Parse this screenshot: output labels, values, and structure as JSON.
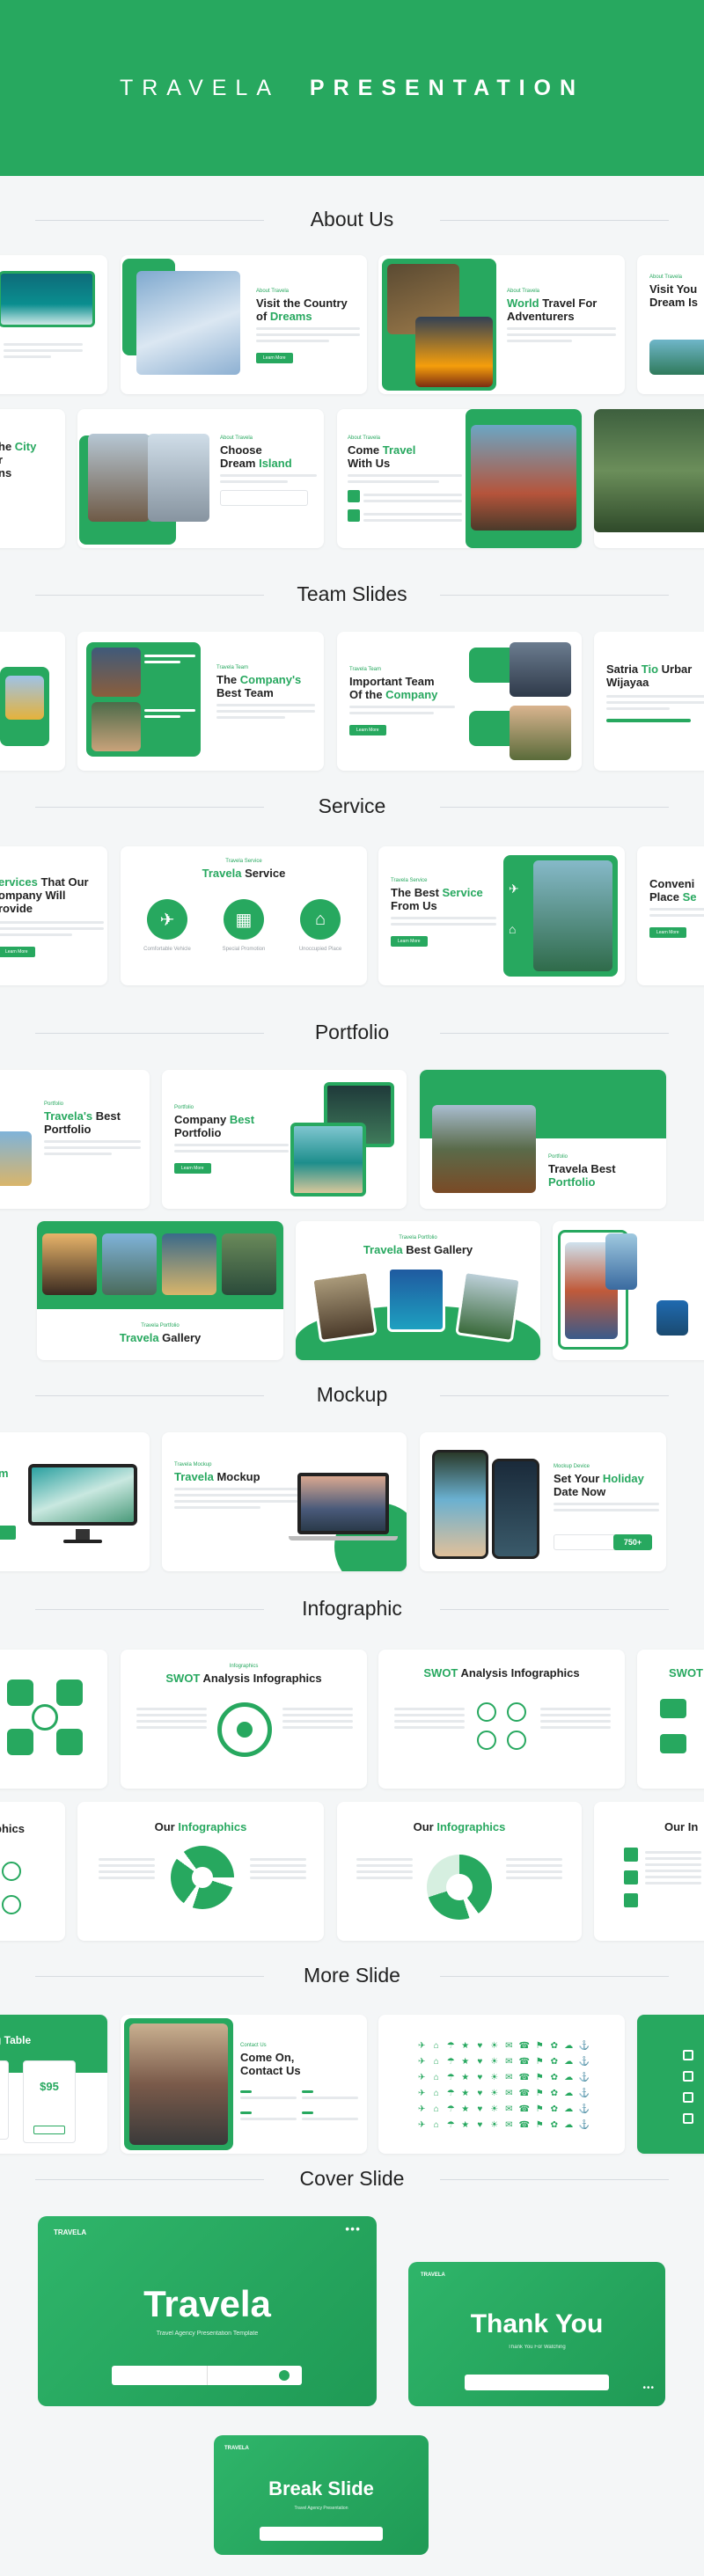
{
  "hero": {
    "title_light": "TRAVELA",
    "title_bold": "PRESENTATION"
  },
  "sections": {
    "about": "About Us",
    "team": "Team Slides",
    "service": "Service",
    "portfolio": "Portfolio",
    "mockup": "Mockup",
    "infographic": "Infographic",
    "more": "More Slide",
    "cover": "Cover Slide"
  },
  "about": {
    "c1": {
      "a": "Visit the Country",
      "b": "of ",
      "c": "Dreams"
    },
    "c2": {
      "a": "World",
      "b": " Travel For Adventurers"
    },
    "c3": {
      "a": "Visit You",
      "b": "Dream Is"
    },
    "c4": {
      "a": "he ",
      "b": "City",
      "c": "r",
      "d": "ns"
    },
    "c5": {
      "a": "Choose",
      "b": "Dream ",
      "c": "Island"
    },
    "c6": {
      "a": "Come ",
      "b": "Travel",
      "c": "With Us"
    }
  },
  "team": {
    "c1": {
      "a": "The ",
      "b": "Company's",
      "c": "Best Team"
    },
    "c2": {
      "a": "Important Team",
      "b": "Of the ",
      "c": "Company"
    },
    "c3": {
      "a": "Satria ",
      "b": "Tio",
      "c": " Urbar",
      "d": "Wijayaa"
    }
  },
  "service": {
    "c1": {
      "a": "ervices",
      "b": " That Our",
      "c": "ompany Will",
      "d": "rovide"
    },
    "c2": {
      "a": "Travela",
      "b": " Service"
    },
    "c3": {
      "a": "The Best ",
      "b": "Service",
      "c": "From Us"
    },
    "c4": {
      "a": "Conveni",
      "b": "Place ",
      "c": "Se"
    }
  },
  "portfolio": {
    "c1": {
      "a": "Travela's",
      "b": " Best",
      "c": "Portfolio"
    },
    "c2": {
      "a": "Company ",
      "b": "Best",
      "c": "Portfolio"
    },
    "c3": {
      "a": "Travela Best",
      "b": "Portfolio"
    },
    "c4": {
      "a": "Travela",
      "b": " Gallery"
    },
    "c5": {
      "a": "Travela",
      "b": " Best Gallery"
    }
  },
  "mockup": {
    "c1": {
      "a": "m"
    },
    "c2": {
      "a": "Travela",
      "b": " Mockup"
    },
    "c3": {
      "a": "Set Your ",
      "b": "Holiday",
      "c": "Date Now",
      "price": "750+"
    }
  },
  "infographic": {
    "c1": {
      "a": "SWOT",
      "b": " Analysis Infographics"
    },
    "c2": {
      "a": "SWOT",
      "b": " Analysis Infographics"
    },
    "c3": {
      "a": "SWOT"
    },
    "c4": {
      "a": "phics"
    },
    "c5": {
      "a": "Our ",
      "b": "Infographics"
    },
    "c6": {
      "a": "Our ",
      "b": "Infographics"
    },
    "c7": {
      "a": "Our In"
    }
  },
  "more": {
    "c1": {
      "a": "g Table",
      "price": "$95"
    },
    "c2": {
      "a": "Come On,",
      "b": "Contact Us"
    }
  },
  "cover": {
    "main": {
      "title": "Travela",
      "sub": "Travel Agency Presentation Template",
      "brand": "TRAVELA"
    },
    "thanks": {
      "title": "Thank You",
      "sub": "Thank You For Watching",
      "brand": "TRAVELA"
    },
    "break": {
      "title": "Break Slide",
      "sub": "Travel Agency Presentation",
      "brand": "TRAVELA"
    }
  },
  "icons": {
    "plane": "plane-icon",
    "building": "building-icon",
    "museum": "museum-icon"
  }
}
